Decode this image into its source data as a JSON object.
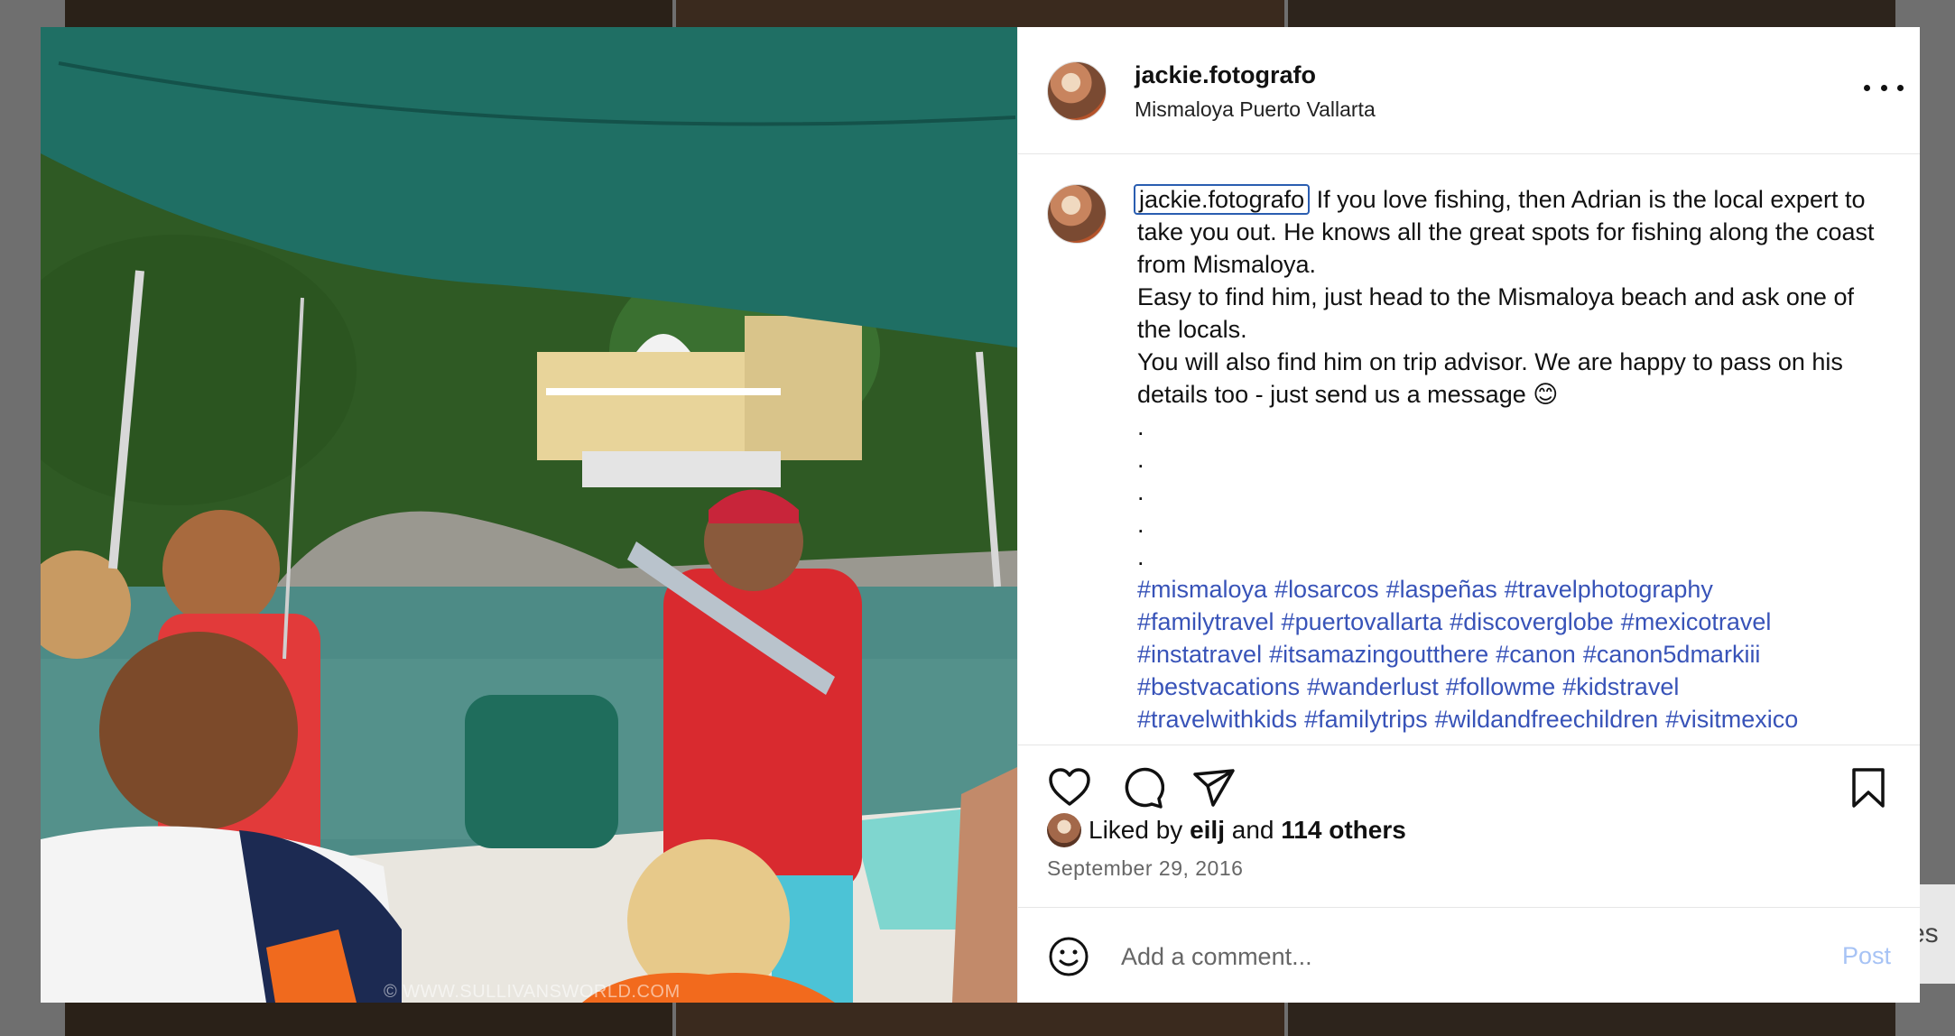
{
  "background": {
    "partial_text": "es"
  },
  "photo": {
    "watermark": "© WWW.SULLIVANSWORLD.COM"
  },
  "post": {
    "username": "jackie.fotografo",
    "location": "Mismaloya Puerto Vallarta",
    "more_icon": "more-horizontal-icon"
  },
  "caption": {
    "author": "jackie.fotografo",
    "lines": [
      "If you love fishing, then Adrian is the local expert to take you out. He knows all the great spots for fishing along the coast from Mismaloya.",
      "Easy to find him, just head to the Mismaloya beach and ask one of the locals.",
      "You will also find him on trip advisor. We are happy to pass on his details too - just send us a message 😊"
    ],
    "dots": [
      ".",
      ".",
      ".",
      ".",
      "."
    ],
    "hashtags": [
      "#mismaloya",
      "#losarcos",
      "#laspeñas",
      "#travelphotography",
      "#familytravel",
      "#puertovallarta",
      "#discoverglobe",
      "#mexicotravel",
      "#instatravel",
      "#itsamazingoutthere",
      "#canon",
      "#canon5dmarkiii",
      "#bestvacations",
      "#wanderlust",
      "#followme",
      "#kidstravel",
      "#travelwithkids",
      "#familytrips",
      "#wildandfreechildren",
      "#visitmexico"
    ]
  },
  "actions": {
    "like_icon": "heart-icon",
    "comment_icon": "comment-icon",
    "share_icon": "paper-plane-icon",
    "save_icon": "bookmark-icon"
  },
  "likes": {
    "prefix": "Liked by",
    "user": "eilj",
    "joiner": "and",
    "others": "114 others"
  },
  "date": "September 29, 2016",
  "comment": {
    "placeholder": "Add a comment...",
    "post_label": "Post"
  },
  "colors": {
    "link_blue": "#3853b8",
    "post_disabled": "#a7c3f5",
    "canopy": "#1f6f64"
  }
}
